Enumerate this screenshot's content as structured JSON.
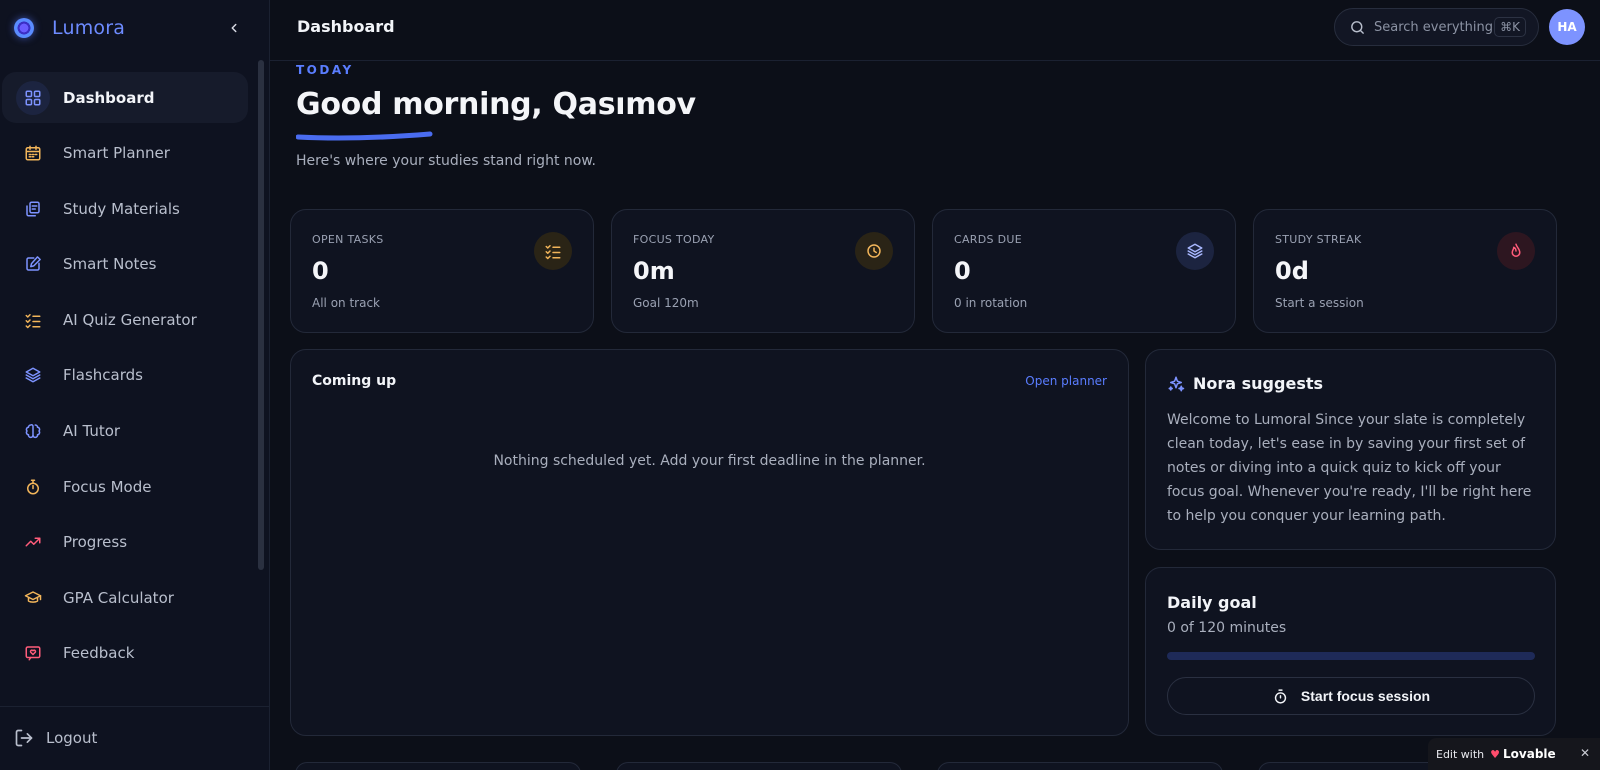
{
  "app": {
    "name": "Lumora"
  },
  "sidebar": {
    "items": [
      {
        "label": "Dashboard",
        "icon": "grid-icon",
        "color": "#7d93ff",
        "active": true
      },
      {
        "label": "Smart Planner",
        "icon": "calendar-icon",
        "color": "#f2b55a"
      },
      {
        "label": "Study Materials",
        "icon": "files-icon",
        "color": "#7d93ff"
      },
      {
        "label": "Smart Notes",
        "icon": "edit-note-icon",
        "color": "#7d93ff"
      },
      {
        "label": "AI Quiz Generator",
        "icon": "checklist-icon",
        "color": "#f2b55a"
      },
      {
        "label": "Flashcards",
        "icon": "layers-icon",
        "color": "#7d93ff"
      },
      {
        "label": "AI Tutor",
        "icon": "brain-icon",
        "color": "#7d93ff"
      },
      {
        "label": "Focus Mode",
        "icon": "timer-icon",
        "color": "#f2b55a"
      },
      {
        "label": "Progress",
        "icon": "trending-up-icon",
        "color": "#ff5c7a"
      },
      {
        "label": "GPA Calculator",
        "icon": "graduation-cap-icon",
        "color": "#f2b55a"
      },
      {
        "label": "Feedback",
        "icon": "heart-message-icon",
        "color": "#ff5c7a"
      }
    ],
    "logout_label": "Logout"
  },
  "header": {
    "title": "Dashboard",
    "search_placeholder": "Search everything",
    "search_shortcut": "⌘K",
    "avatar_initials": "HA"
  },
  "hero": {
    "eyebrow": "TODAY",
    "greeting": "Good morning, Qasımov",
    "subtitle": "Here's where your studies stand right now."
  },
  "stats": [
    {
      "label": "OPEN TASKS",
      "value": "0",
      "sub": "All on track",
      "icon": "checklist-icon",
      "color": "#f2b55a",
      "bg": "#2a2416"
    },
    {
      "label": "FOCUS TODAY",
      "value": "0m",
      "sub": "Goal 120m",
      "icon": "clock-icon",
      "color": "#f2b55a",
      "bg": "#2a2416"
    },
    {
      "label": "CARDS DUE",
      "value": "0",
      "sub": "0 in rotation",
      "icon": "layers-icon",
      "color": "#a9b8ff",
      "bg": "#1c2440"
    },
    {
      "label": "STUDY STREAK",
      "value": "0d",
      "sub": "Start a session",
      "icon": "flame-icon",
      "color": "#ff5c7a",
      "bg": "#2d1620"
    }
  ],
  "coming_up": {
    "title": "Coming up",
    "link": "Open planner",
    "empty": "Nothing scheduled yet. Add your first deadline in the planner."
  },
  "nora": {
    "title": "Nora suggests",
    "body": "Welcome to Lumoral Since your slate is completely clean today, let's ease in by saving your first set of notes or diving into a quick quiz to kick off your focus goal. Whenever you're ready, I'll be right here to help you conquer your learning path."
  },
  "daily_goal": {
    "title": "Daily goal",
    "progress_text": "0 of 120 minutes",
    "progress_fraction": 0,
    "button": "Start focus session"
  },
  "badge": {
    "text": "Edit with",
    "brand": "Lovable"
  },
  "colors": {
    "accent": "#5a7dff",
    "background": "#0c0f18",
    "card": "#0f1320"
  }
}
